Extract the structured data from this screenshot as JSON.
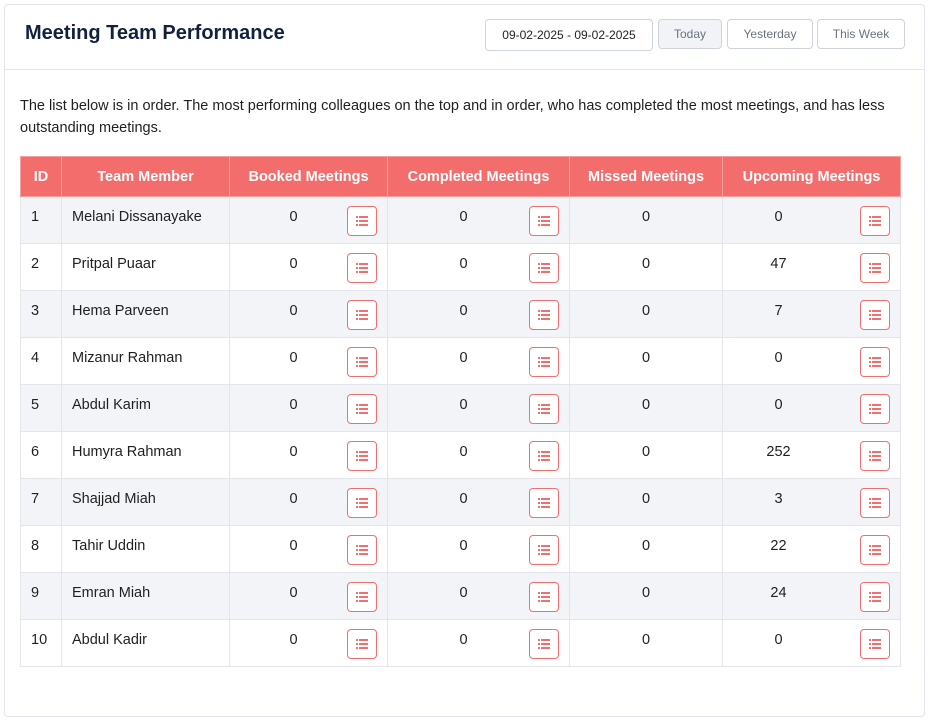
{
  "header": {
    "title": "Meeting Team Performance",
    "date_range": "09-02-2025 - 09-02-2025",
    "buttons": {
      "today": "Today",
      "yesterday": "Yesterday",
      "this_week": "This Week"
    }
  },
  "intro_text": "The list below is in order. The most performing colleagues on the top and in order, who has completed the most meetings, and has less outstanding meetings.",
  "table": {
    "columns": [
      "ID",
      "Team Member",
      "Booked Meetings",
      "Completed Meetings",
      "Missed Meetings",
      "Upcoming Meetings"
    ],
    "rows": [
      {
        "id": "1",
        "name": "Melani Dissanayake",
        "booked": "0",
        "completed": "0",
        "missed": "0",
        "upcoming": "0"
      },
      {
        "id": "2",
        "name": "Pritpal Puaar",
        "booked": "0",
        "completed": "0",
        "missed": "0",
        "upcoming": "47"
      },
      {
        "id": "3",
        "name": "Hema Parveen",
        "booked": "0",
        "completed": "0",
        "missed": "0",
        "upcoming": "7"
      },
      {
        "id": "4",
        "name": "Mizanur Rahman",
        "booked": "0",
        "completed": "0",
        "missed": "0",
        "upcoming": "0"
      },
      {
        "id": "5",
        "name": "Abdul Karim",
        "booked": "0",
        "completed": "0",
        "missed": "0",
        "upcoming": "0"
      },
      {
        "id": "6",
        "name": "Humyra Rahman",
        "booked": "0",
        "completed": "0",
        "missed": "0",
        "upcoming": "252"
      },
      {
        "id": "7",
        "name": "Shajjad Miah",
        "booked": "0",
        "completed": "0",
        "missed": "0",
        "upcoming": "3"
      },
      {
        "id": "8",
        "name": "Tahir Uddin",
        "booked": "0",
        "completed": "0",
        "missed": "0",
        "upcoming": "22"
      },
      {
        "id": "9",
        "name": "Emran Miah",
        "booked": "0",
        "completed": "0",
        "missed": "0",
        "upcoming": "24"
      },
      {
        "id": "10",
        "name": "Abdul Kadir",
        "booked": "0",
        "completed": "0",
        "missed": "0",
        "upcoming": "0"
      }
    ]
  },
  "icons": {
    "row_action": "list-icon"
  },
  "colors": {
    "header_bg": "#f46d6d",
    "accent": "#f07070",
    "title": "#14213d",
    "stripe": "#f3f4f8"
  }
}
